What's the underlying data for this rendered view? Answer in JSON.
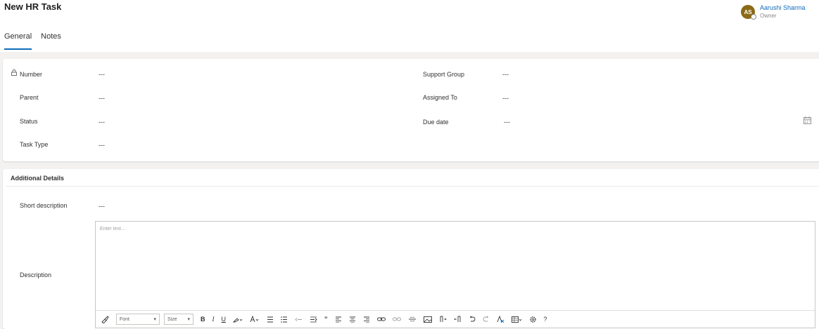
{
  "header": {
    "title": "New HR Task",
    "owner": {
      "initials": "AS",
      "name": "Aarushi Sharma",
      "role": "Owner"
    }
  },
  "tabs": [
    "General",
    "Notes"
  ],
  "general": {
    "number": {
      "label": "Number",
      "value": "---"
    },
    "parent": {
      "label": "Parent",
      "value": "---"
    },
    "status": {
      "label": "Status",
      "value": "---"
    },
    "task_type": {
      "label": "Task Type",
      "value": "---"
    },
    "support_group": {
      "label": "Support Group",
      "value": "---"
    },
    "assigned_to": {
      "label": "Assigned To",
      "value": "---"
    },
    "due_date": {
      "label": "Due date",
      "value": "---"
    }
  },
  "additional": {
    "title": "Additional Details",
    "short_description": {
      "label": "Short description",
      "value": "---"
    },
    "description": {
      "label": "Description",
      "placeholder": "Enter text..."
    }
  },
  "toolbar": {
    "font": "Font",
    "size": "Size",
    "bold": "B",
    "italic": "I",
    "underline": "U",
    "quote": "”",
    "help": "?"
  },
  "colors": {
    "accent": "#0f6cbd",
    "avatar": "#8a6a16"
  }
}
